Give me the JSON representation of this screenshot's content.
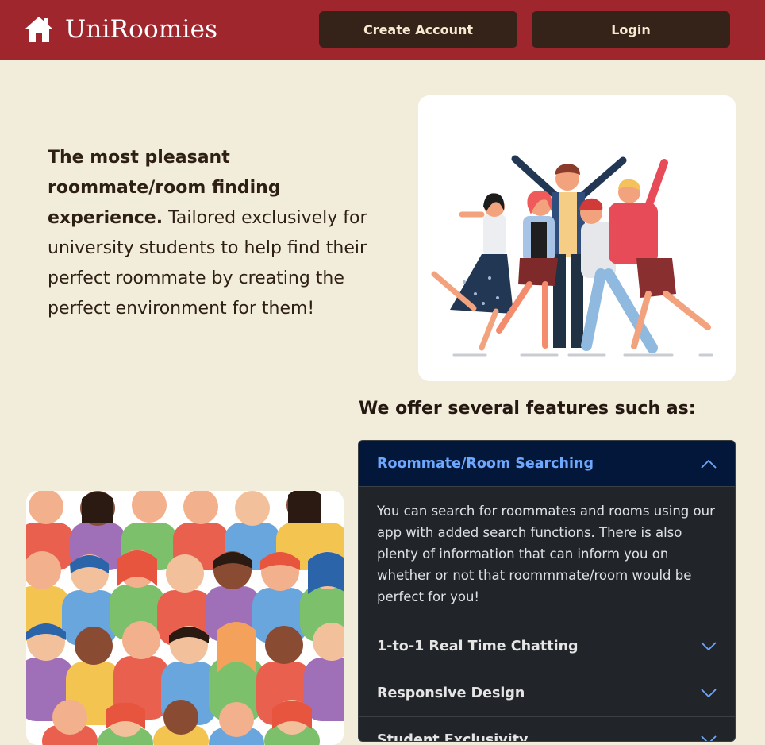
{
  "navbar": {
    "brand": "UniRoomies",
    "brand_icon": "house-icon",
    "create_account": "Create Account",
    "login": "Login"
  },
  "intro": {
    "bold_text": "The most pleasant roommate/room finding experience.",
    "text": " Tailored exclusively for university students to help find their perfect roommate by creating the perfect environment for them!"
  },
  "hero_image": {
    "icon": "group-of-friends-illustration"
  },
  "crowd_image": {
    "icon": "crowd-illustration"
  },
  "features": {
    "heading": "We offer several features such as:",
    "items": [
      {
        "title": "Roommate/Room Searching",
        "expanded": true,
        "body": "You can search for roommates and rooms using our app with added search functions. There is also plenty of information that can inform you on whether or not that roommmate/room would be perfect for you!"
      },
      {
        "title": "1-to-1 Real Time Chatting",
        "expanded": false
      },
      {
        "title": "Responsive Design",
        "expanded": false
      },
      {
        "title": "Student Exclusivity",
        "expanded": false
      }
    ]
  },
  "colors": {
    "navbar": "#9f262c",
    "background": "#f2ecdb",
    "button": "#35231a",
    "accordion": "#212529",
    "accordion_active": "#03173a",
    "accent": "#6ea8fe"
  }
}
